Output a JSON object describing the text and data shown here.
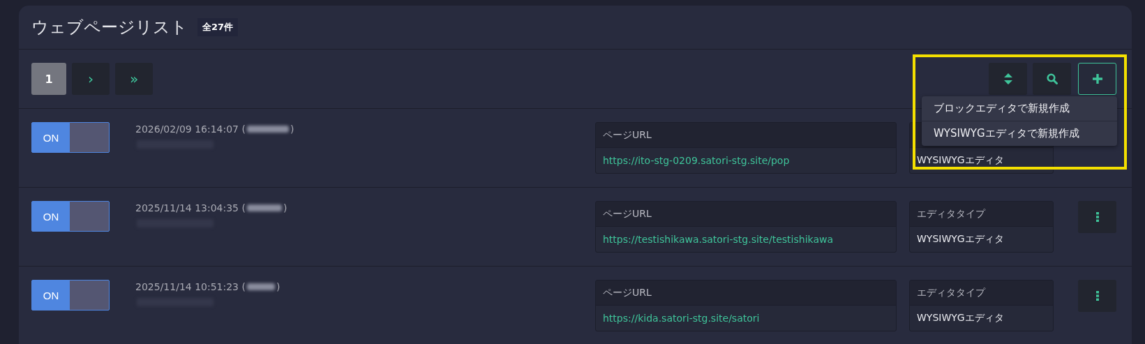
{
  "header": {
    "title": "ウェブページリスト",
    "count": "全27件"
  },
  "pagination": [
    {
      "label": "1",
      "kind": "page",
      "selected": true
    },
    {
      "label": "›",
      "kind": "next",
      "selected": false
    },
    {
      "label": "»",
      "kind": "last",
      "selected": false
    }
  ],
  "toolbar": {
    "dropdown_open": true,
    "menu_items": [
      "ブロックエディタで新規作成",
      "WYSIWYGエディタで新規作成"
    ]
  },
  "rows": [
    {
      "toggle": {
        "label": "ON",
        "on": true
      },
      "updated": "2026/02/09 16:14:07 (",
      "updated_end": ")",
      "url_label": "ページURL",
      "url": "https://ito-stg-0209.satori-stg.site/pop",
      "editor": "WYSIWYGエディタ",
      "menu_visible": false
    },
    {
      "toggle": {
        "label": "ON",
        "on": true
      },
      "updated": "2025/11/14 13:04:35 (",
      "updated_end": ")",
      "url_label": "ページURL",
      "url": "https://testishikawa.satori-stg.site/testishikawa",
      "editor_label": "エディタタイプ",
      "editor": "WYSIWYGエディタ",
      "menu_visible": true
    },
    {
      "toggle": {
        "label": "ON",
        "on": true
      },
      "updated": "2025/11/14 10:51:23 (",
      "updated_end": ")",
      "url_label": "ページURL",
      "url": "https://kida.satori-stg.site/satori",
      "editor_label": "エディタタイプ",
      "editor": "WYSIWYGエディタ",
      "menu_visible": true
    }
  ]
}
